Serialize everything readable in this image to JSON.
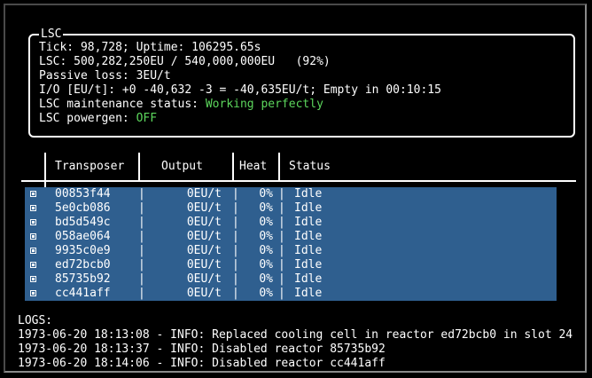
{
  "lsc": {
    "title": "LSC",
    "tick_line": "Tick: 98,728; Uptime: 106295.65s",
    "storage_line": "LSC: 500,282,250EU / 540,000,000EU   (92%)",
    "passive_loss_line": "Passive loss: 3EU/t",
    "io_line": "I/O [EU/t]: +0 -40,632 -3 = -40,635EU/t; Empty in 00:10:15",
    "maintenance_label": "LSC maintenance status: ",
    "maintenance_value": "Working perfectly",
    "powergen_label": "LSC powergen: ",
    "powergen_value": "OFF"
  },
  "table": {
    "headers": [
      "Transposer",
      "Output",
      "Heat",
      "Status"
    ],
    "rows": [
      {
        "transposer": "00853f44",
        "output": "0EU/t",
        "heat": "0%",
        "status": "Idle"
      },
      {
        "transposer": "5e0cb086",
        "output": "0EU/t",
        "heat": "0%",
        "status": "Idle"
      },
      {
        "transposer": "bd5d549c",
        "output": "0EU/t",
        "heat": "0%",
        "status": "Idle"
      },
      {
        "transposer": "058ae064",
        "output": "0EU/t",
        "heat": "0%",
        "status": "Idle"
      },
      {
        "transposer": "9935c0e9",
        "output": "0EU/t",
        "heat": "0%",
        "status": "Idle"
      },
      {
        "transposer": "ed72bcb0",
        "output": "0EU/t",
        "heat": "0%",
        "status": "Idle"
      },
      {
        "transposer": "85735b92",
        "output": "0EU/t",
        "heat": "0%",
        "status": "Idle"
      },
      {
        "transposer": "cc441aff",
        "output": "0EU/t",
        "heat": "0%",
        "status": "Idle"
      }
    ]
  },
  "logs": {
    "title": "LOGS:",
    "entries": [
      "1973-06-20 18:13:08 - INFO: Replaced cooling cell in reactor ed72bcb0 in slot 24",
      "1973-06-20 18:13:37 - INFO: Disabled reactor 85735b92",
      "1973-06-20 18:14:06 - INFO: Disabled reactor cc441aff"
    ]
  },
  "colors": {
    "background": "#000000",
    "text": "#ffffff",
    "ok_green": "#5cd65c",
    "row_highlight": "#2f5f8f"
  }
}
